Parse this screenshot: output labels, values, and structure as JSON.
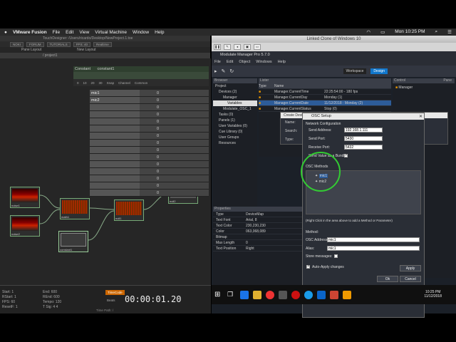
{
  "menubar": {
    "app": "VMware Fusion",
    "items": [
      "File",
      "Edit",
      "View",
      "Virtual Machine",
      "Window",
      "Help"
    ],
    "clock": "Mon 10:25 PM"
  },
  "td": {
    "title": "TouchDesigner: /Users/ricardo/Desktop/NewProject.1.toe",
    "toolbar": [
      "NOKI",
      "FORUM",
      "TUTORIALS",
      "FPS: 40",
      "Realtime"
    ],
    "toolbar2": [
      "Pane Layout",
      "New Layout"
    ],
    "path": "/ project1",
    "param_title": "Constant",
    "param_name": "constant1",
    "param_tabs": [
      "0",
      "10",
      "20",
      "30",
      "Snap",
      "Channel",
      "Common"
    ],
    "channels": [
      {
        "name": "mic1",
        "value": "0"
      },
      {
        "name": "mic2",
        "value": "0"
      },
      {
        "name": "",
        "value": "0"
      },
      {
        "name": "",
        "value": "0"
      },
      {
        "name": "",
        "value": "0"
      },
      {
        "name": "",
        "value": "0"
      },
      {
        "name": "",
        "value": "0"
      },
      {
        "name": "",
        "value": "0"
      },
      {
        "name": "",
        "value": "0"
      },
      {
        "name": "",
        "value": "0"
      },
      {
        "name": "",
        "value": "0"
      },
      {
        "name": "",
        "value": "0"
      },
      {
        "name": "",
        "value": "0"
      },
      {
        "name": "",
        "value": "0"
      },
      {
        "name": "",
        "value": "0"
      }
    ],
    "nodes": {
      "n1": "noise1",
      "n2": "noise2",
      "n3": "math1",
      "n4": "null1",
      "n5": "constant1",
      "n6": "null2"
    },
    "bottom": {
      "start_label": "Start:",
      "start_val": "1",
      "end_label": "End:",
      "end_val": "600",
      "rstart_label": "RStart:",
      "rstart_val": "1",
      "rend_label": "REnd:",
      "rend_val": "600",
      "fps_label": "FPS:",
      "fps_val": "60",
      "tempo_label": "Tempo:",
      "tempo_val": "120",
      "resetf_label": "ResetF:",
      "resetf_val": "1",
      "tsig_label": "T Sig:",
      "tsig_val": "4",
      "tsig_val2": "4",
      "timecode_btn": "TimeCode",
      "beats": "Beats",
      "timecode": "00:00:01.20",
      "timepath": "Time Path: /"
    }
  },
  "vm": {
    "title": "Linked Clone of Windows 10",
    "mm_title": "Modulate Manager Pro 5.7.0",
    "mm_menu": [
      "File",
      "Edit",
      "Object",
      "Windows",
      "Help"
    ],
    "workspace": "Workspace",
    "design": "Design",
    "browser": {
      "header": "Browser",
      "root": "Project",
      "items": [
        "Devices (2)",
        "Manager",
        "Variables",
        "Modulate_OSC_1",
        "Tasks (0)",
        "Panels (1)",
        "User Variables (0)",
        "Cue Library (0)",
        "User Groups",
        "Resources"
      ]
    },
    "lister": {
      "header": "Lister",
      "col_type": "Type",
      "col_name": "Name",
      "rows": [
        {
          "name": "Manager.CurrentTime",
          "value": "22:25:54:00 - 180 fps"
        },
        {
          "name": "Manager.CurrentDay",
          "value": "Monday (1)"
        },
        {
          "name": "Manager.CurrentDate",
          "value": "11/12/2018 : Monday (2)"
        },
        {
          "name": "Manager.CurrentStatus",
          "value": "Stop (0)"
        }
      ]
    },
    "control": {
      "header": "Control",
      "panel": "Pane",
      "item": "Manager"
    },
    "props": {
      "header": "Properties",
      "rows": [
        {
          "k": "Type",
          "v": "DeviceMap"
        },
        {
          "k": "Text Font",
          "v": "Arial, 8"
        },
        {
          "k": "Text Color",
          "v": "230,230,230"
        },
        {
          "k": "Color",
          "v": "063,068,089"
        },
        {
          "k": "Bitmap",
          "v": ""
        },
        {
          "k": "Max Length",
          "v": "0"
        },
        {
          "k": "Text Position",
          "v": "Right"
        }
      ]
    },
    "createdev": {
      "title": "Create Device",
      "name_label": "Name:",
      "search_label": "Search:",
      "type_label": "Type:"
    },
    "osc": {
      "title": "OSC Setup",
      "net_config": "Network Configuration",
      "send_addr_label": "Send Address:",
      "send_addr": "192.168.1.111",
      "send_port_label": "Send Port:",
      "send_port": "5430",
      "recv_port_label": "Receive Port:",
      "recv_port": "5432",
      "bundle_label": "Send Value as a Bundle:",
      "methods_label": "OSC Methods",
      "m1": "mic1",
      "m2": "mic2",
      "hint": "(Right Click in the area above to add a Method or Parameter)",
      "method_label": "Method:",
      "addr_label": "OSC Address:",
      "addr_val": "mic1",
      "alias_label": "Alias:",
      "alias_val": "mic1",
      "store_label": "Store messages:",
      "auto_label": "Auto-Apply changes",
      "apply": "Apply",
      "ok": "Ok",
      "cancel": "Cancel"
    },
    "taskbar": {
      "time": "10:25 PM",
      "date": "11/12/2018"
    }
  }
}
